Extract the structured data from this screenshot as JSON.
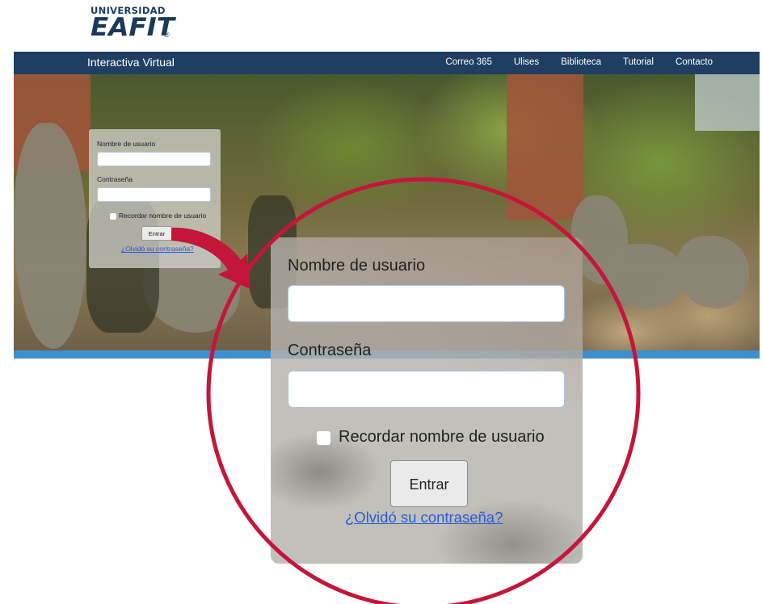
{
  "logo": {
    "top_text": "UNIVERSIDAD",
    "main_text": "EAFIT",
    "reg_mark": "®"
  },
  "navbar": {
    "title": "Interactiva Virtual",
    "links": [
      "Correo 365",
      "Ulises",
      "Biblioteca",
      "Tutorial",
      "Contacto"
    ]
  },
  "login": {
    "username_label": "Nombre de usuario",
    "username_value": "",
    "password_label": "Contraseña",
    "password_value": "",
    "remember_label": "Recordar nombre de usuario",
    "submit_label": "Entrar",
    "forgot_label": "¿Olvidó su contraseña?"
  },
  "colors": {
    "navbar": "#1e3f62",
    "accent_bar": "#3d8fd0",
    "highlight_circle": "#c4163a",
    "link": "#2a5bd7"
  }
}
